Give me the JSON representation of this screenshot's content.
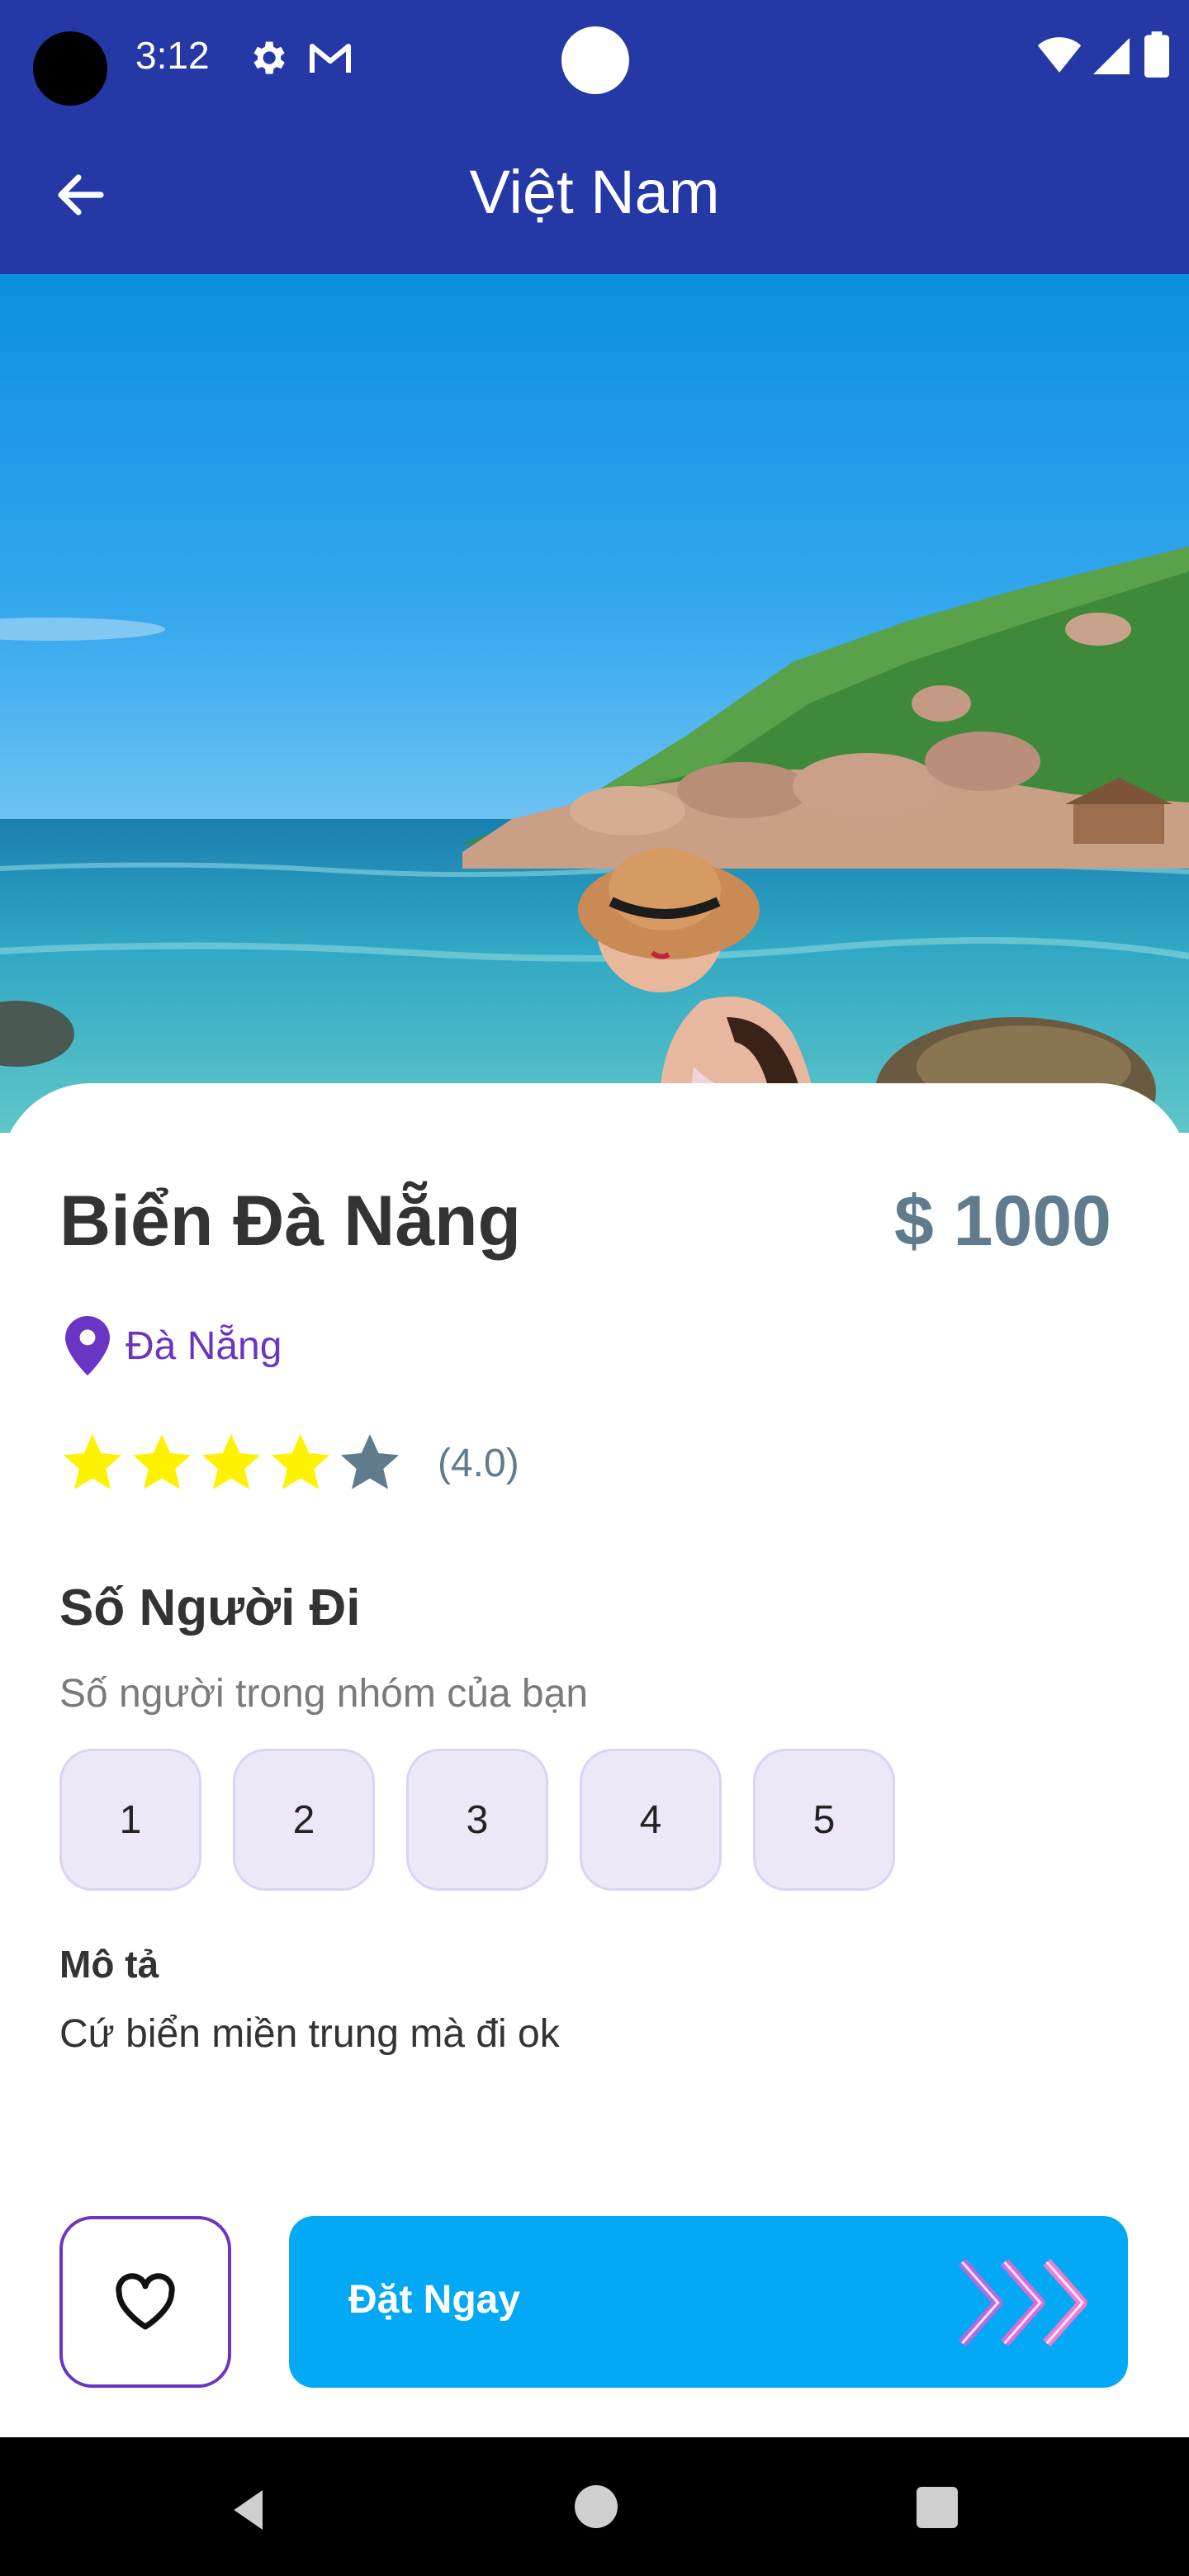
{
  "status_bar": {
    "time": "3:12"
  },
  "app_bar": {
    "title": "Việt Nam"
  },
  "detail": {
    "place_name": "Biển Đà Nẵng",
    "price": "$ 1000",
    "location": "Đà Nẵng",
    "rating": {
      "value": 4,
      "max": 5,
      "label": "(4.0)"
    }
  },
  "people": {
    "title": "Số Người Đi",
    "subtitle": "Số người trong nhóm của bạn",
    "options": [
      "1",
      "2",
      "3",
      "4",
      "5"
    ]
  },
  "description": {
    "title": "Mô tả",
    "text": "Cứ biển miền trung mà đi ok"
  },
  "actions": {
    "book_label": "Đặt Ngay"
  },
  "colors": {
    "app_bar": "#2438a6",
    "accent_purple": "#6a35c3",
    "price": "#5f7b8c",
    "book_button": "#03a9f4",
    "star_filled": "#fff200",
    "star_empty": "#5f7b8c",
    "chip_bg": "#ede8f7"
  },
  "icons": {
    "back": "arrow-left-icon",
    "location": "map-pin-icon",
    "favorite": "heart-outline-icon",
    "book_arrows": "triple-chevron-right-icon"
  }
}
